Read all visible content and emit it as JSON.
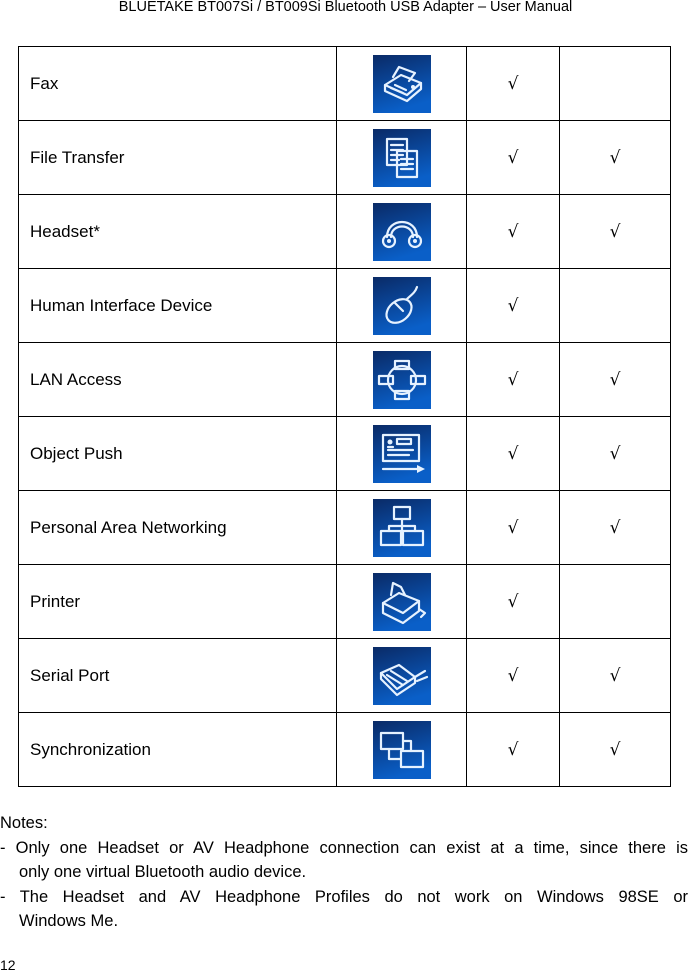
{
  "header": {
    "title": "BLUETAKE BT007Si / BT009Si Bluetooth USB Adapter – User Manual"
  },
  "table": {
    "rows": [
      {
        "name": "Fax",
        "icon": "fax-icon",
        "col1": "√",
        "col2": ""
      },
      {
        "name": "File Transfer",
        "icon": "file-transfer-icon",
        "col1": "√",
        "col2": "√"
      },
      {
        "name": "Headset*",
        "icon": "headset-icon",
        "col1": "√",
        "col2": "√"
      },
      {
        "name": "Human Interface Device",
        "icon": "mouse-icon",
        "col1": "√",
        "col2": ""
      },
      {
        "name": "LAN Access",
        "icon": "lan-access-icon",
        "col1": "√",
        "col2": "√"
      },
      {
        "name": "Object Push",
        "icon": "object-push-icon",
        "col1": "√",
        "col2": "√"
      },
      {
        "name": "Personal Area Networking",
        "icon": "network-icon",
        "col1": "√",
        "col2": "√"
      },
      {
        "name": "Printer",
        "icon": "printer-icon",
        "col1": "√",
        "col2": ""
      },
      {
        "name": "Serial Port",
        "icon": "serial-port-icon",
        "col1": "√",
        "col2": "√"
      },
      {
        "name": "Synchronization",
        "icon": "sync-icon",
        "col1": "√",
        "col2": "√"
      }
    ]
  },
  "notes": {
    "heading": "Notes:",
    "note1_line1": "- Only one Headset or AV Headphone connection can exist at a time, since there is",
    "note1_line2": "only one virtual Bluetooth audio device.",
    "note2_line1": "- The Headset and AV Headphone Profiles do not work on Windows 98SE or",
    "note2_line2": "Windows Me."
  },
  "footer": {
    "page_number": "12"
  },
  "colors": {
    "icon_dark": "#0a2a66",
    "icon_light": "#0a5fc8",
    "icon_stroke": "#e6f2ff"
  }
}
